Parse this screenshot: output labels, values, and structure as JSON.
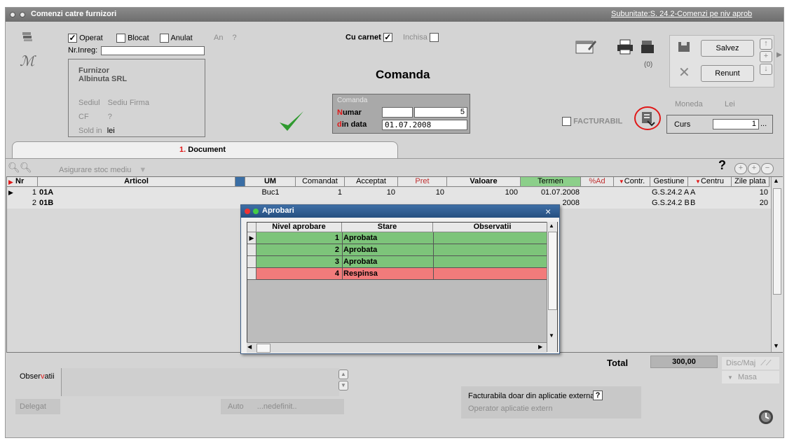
{
  "window": {
    "title": "Comenzi catre furnizori",
    "subunit_link": "Subunitate:S. 24.2-Comenzi pe niv aprob"
  },
  "flags": {
    "operat_label": "Operat",
    "operat_checked": "✓",
    "blocat_label": "Blocat",
    "anulat_label": "Anulat",
    "an_label": "An",
    "an_value": "?",
    "nr_inreg_label": "Nr.Inreg:",
    "cu_carnet_label": "Cu carnet",
    "cu_carnet_checked": "✓",
    "inchisa_label": "Inchisa"
  },
  "supplier": {
    "label": "Furnizor",
    "name": "Albinuta SRL",
    "sediul_label": "Sediul",
    "sediul_value": "Sediu Firma",
    "cf_label": "CF",
    "cf_value": "?",
    "sold_label": "Sold in",
    "sold_value": "lei"
  },
  "heading": "Comanda",
  "order_box": {
    "title": "Comanda",
    "numar_prefix": "N",
    "numar_label": "umar",
    "numar_value": "5",
    "data_prefix": "d",
    "data_label": "in data",
    "data_value": "01.07.2008"
  },
  "counter": "(0)",
  "buttons": {
    "save": "Salvez",
    "cancel": "Renunt"
  },
  "currency": {
    "moneda_label": "Moneda",
    "moneda_value": "Lei",
    "curs_label": "Curs",
    "curs_value": "1",
    "curs_more": "..."
  },
  "facturabil_label": "FACTURABIL",
  "tab": {
    "number": "1.",
    "label": "Document"
  },
  "toolbar": {
    "asigurare_label": "Asigurare stoc mediu",
    "help": "?"
  },
  "grid": {
    "columns": [
      "Nr",
      "Articol",
      "UM",
      "Comandat",
      "Acceptat",
      "Pret",
      "Valoare",
      "Termen",
      "%Ad",
      "Contr.",
      "Gestiune",
      "Centru cos",
      "Zile plata"
    ],
    "rows": [
      {
        "nr": "1",
        "articol": "01A",
        "um": "Buc1",
        "comandat": "1",
        "acceptat": "10",
        "pret": "10",
        "valoare": "100",
        "termen": "01.07.2008",
        "gestiune": "G.S.24.2 A",
        "centru": "A",
        "zile": "10"
      },
      {
        "nr": "2",
        "articol": "01B",
        "um": "",
        "comandat": "",
        "acceptat": "",
        "pret": "",
        "valoare": "",
        "termen": "2008",
        "gestiune": "G.S.24.2 B",
        "centru": "B",
        "zile": "20"
      }
    ]
  },
  "approvals": {
    "title": "Aprobari",
    "close": "×",
    "columns": [
      "Nivel aprobare",
      "Stare",
      "Observatii"
    ],
    "rows": [
      {
        "level": "1",
        "state": "Aprobata",
        "status": "approved"
      },
      {
        "level": "2",
        "state": "Aprobata",
        "status": "approved"
      },
      {
        "level": "3",
        "state": "Aprobata",
        "status": "approved"
      },
      {
        "level": "4",
        "state": "Respinsa",
        "status": "rejected"
      }
    ],
    "colors": {
      "approved": "#7dc47a",
      "rejected": "#f27b7b"
    }
  },
  "totals": {
    "label": "Total",
    "value": "300,00",
    "disc_label": "Disc/Maj",
    "masa_label": "Masa"
  },
  "bottom": {
    "observatii_prefix": "Obser",
    "observatii_accent": "v",
    "observatii_suffix": "atii",
    "delegat_label": "Delegat",
    "auto_label": "Auto",
    "auto_value": "...nedefinit..",
    "ext_label": "Facturabila doar din aplicatie externa",
    "ext_value": "?",
    "operator_label": "Operator aplicatie extern"
  },
  "colors": {
    "titlebar": "#777777",
    "dialog_title": "#2f5d8e",
    "accent_red": "#e01818"
  }
}
